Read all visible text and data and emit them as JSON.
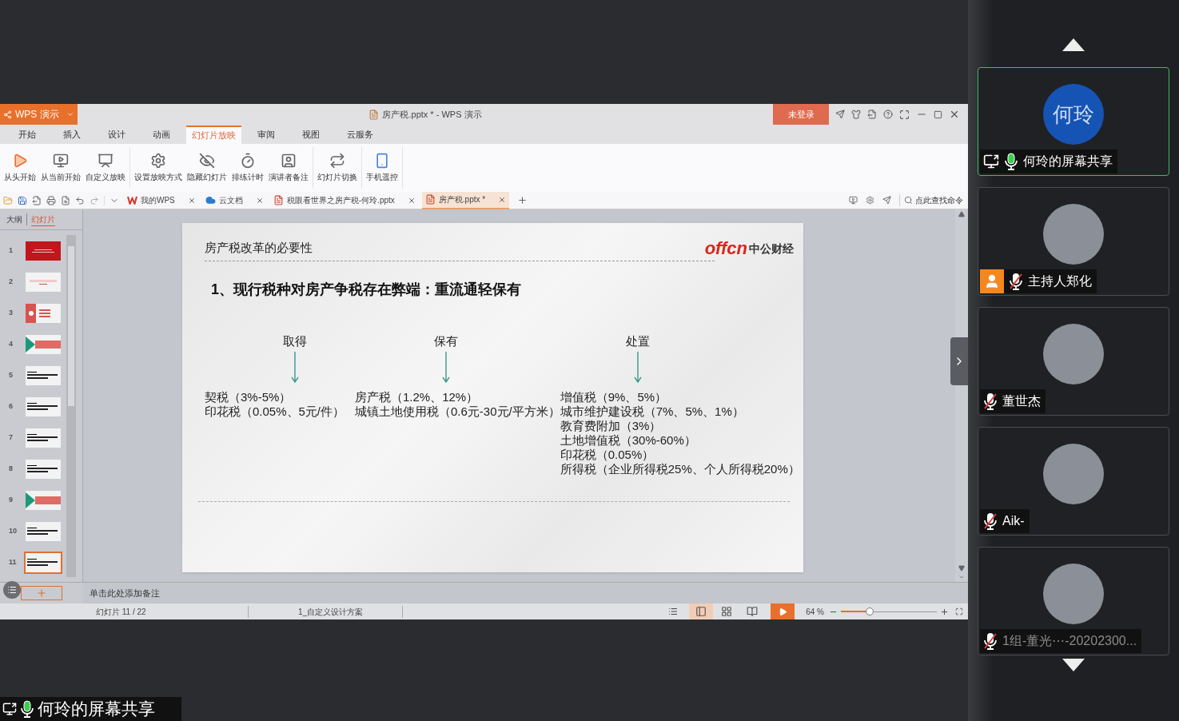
{
  "app": {
    "name": "WPS 演示",
    "doc_title": "房产税.pptx * - WPS 演示",
    "login": "未登录"
  },
  "menu_tabs": [
    {
      "label": "开始",
      "selected": false
    },
    {
      "label": "插入",
      "selected": false
    },
    {
      "label": "设计",
      "selected": false
    },
    {
      "label": "动画",
      "selected": false
    },
    {
      "label": "幻灯片放映",
      "selected": true
    },
    {
      "label": "审阅",
      "selected": false
    },
    {
      "label": "视图",
      "selected": false
    },
    {
      "label": "云服务",
      "selected": false
    }
  ],
  "ribbon_groups": [
    [
      {
        "kind": "play",
        "label": "从头开始"
      },
      {
        "kind": "current",
        "label": "从当前开始"
      },
      {
        "kind": "custom",
        "label": "自定义放映"
      }
    ],
    [
      {
        "kind": "setup",
        "label": "设置放映方式"
      },
      {
        "kind": "hide",
        "label": "隐藏幻灯片"
      },
      {
        "kind": "rehearse",
        "label": "排练计时"
      },
      {
        "kind": "notes",
        "label": "演讲者备注"
      }
    ],
    [
      {
        "kind": "transition",
        "label": "幻灯片切换"
      }
    ],
    [
      {
        "kind": "remote",
        "label": "手机遥控"
      }
    ]
  ],
  "doc_tabs": [
    {
      "kind": "wps",
      "label": "我的WPS",
      "selected": false
    },
    {
      "kind": "cloud",
      "label": "云文档",
      "selected": false
    },
    {
      "kind": "file",
      "label": "税眼看世界之房产税-何玲.pptx",
      "selected": false
    },
    {
      "kind": "file",
      "label": "房产税.pptx *",
      "selected": true
    }
  ],
  "command_search": "点此查找命令",
  "sidebar": {
    "tabs": [
      {
        "label": "大纲",
        "selected": false
      },
      {
        "label": "幻灯片",
        "selected": true
      }
    ],
    "slides": [
      {
        "number": "1",
        "kind": "title",
        "selected": false
      },
      {
        "number": "2",
        "kind": "intro",
        "selected": false
      },
      {
        "number": "3",
        "kind": "agenda",
        "selected": false
      },
      {
        "number": "4",
        "kind": "section",
        "selected": false
      },
      {
        "number": "5",
        "kind": "text",
        "selected": false
      },
      {
        "number": "6",
        "kind": "text",
        "selected": false
      },
      {
        "number": "7",
        "kind": "text",
        "selected": false
      },
      {
        "number": "8",
        "kind": "text",
        "selected": false
      },
      {
        "number": "9",
        "kind": "section",
        "selected": false
      },
      {
        "number": "10",
        "kind": "text",
        "selected": false
      },
      {
        "number": "11",
        "kind": "text",
        "selected": true
      }
    ]
  },
  "slide": {
    "header": "房产税改革的必要性",
    "logo_text": "offcn",
    "logo_cn": "中公财经",
    "heading": "1、现行税种对房产争税存在弊端：重流通轻保有",
    "columns": [
      {
        "title": "取得",
        "items": [
          "契税（3%-5%）",
          "印花税（0.05%、5元/件）"
        ]
      },
      {
        "title": "保有",
        "items": [
          "房产税（1.2%、12%）",
          "城镇土地使用税（0.6元-30元/平方米）"
        ]
      },
      {
        "title": "处置",
        "items": [
          "增值税（9%、5%）",
          "城市维护建设税（7%、5%、1%）",
          "教育费附加（3%）",
          "土地增值税（30%-60%）",
          "印花税（0.05%）",
          "所得税（企业所得税25%、个人所得税20%）"
        ]
      }
    ]
  },
  "notes_placeholder": "单击此处添加备注",
  "status_bar": {
    "slide_count": "幻灯片 11 / 22",
    "theme": "1_自定义设计方案",
    "views": [
      {
        "kind": "normal",
        "selected": true
      },
      {
        "kind": "sorter",
        "selected": false
      },
      {
        "kind": "reading",
        "selected": false
      }
    ],
    "zoom": "64 %",
    "level": 0.3
  },
  "share_label": "何玲的屏幕共享",
  "participants": [
    {
      "name": "何玲的屏幕共享",
      "kind": "initials",
      "avatar_text": "何玲",
      "muted": false,
      "host": false,
      "sharing": true,
      "selected": true,
      "dimmed": false
    },
    {
      "name": "主持人郑化",
      "kind": "photo",
      "muted": true,
      "host": true,
      "sharing": false,
      "selected": false,
      "dimmed": false
    },
    {
      "name": "董世杰",
      "kind": "photo",
      "muted": true,
      "host": false,
      "sharing": false,
      "selected": false,
      "dimmed": false
    },
    {
      "name": "Aik-",
      "kind": "photo",
      "muted": true,
      "host": false,
      "sharing": false,
      "selected": false,
      "dimmed": false
    },
    {
      "name": "1组-董光⋯-20202300...",
      "kind": "photo",
      "muted": true,
      "host": false,
      "sharing": false,
      "selected": false,
      "dimmed": true
    }
  ]
}
